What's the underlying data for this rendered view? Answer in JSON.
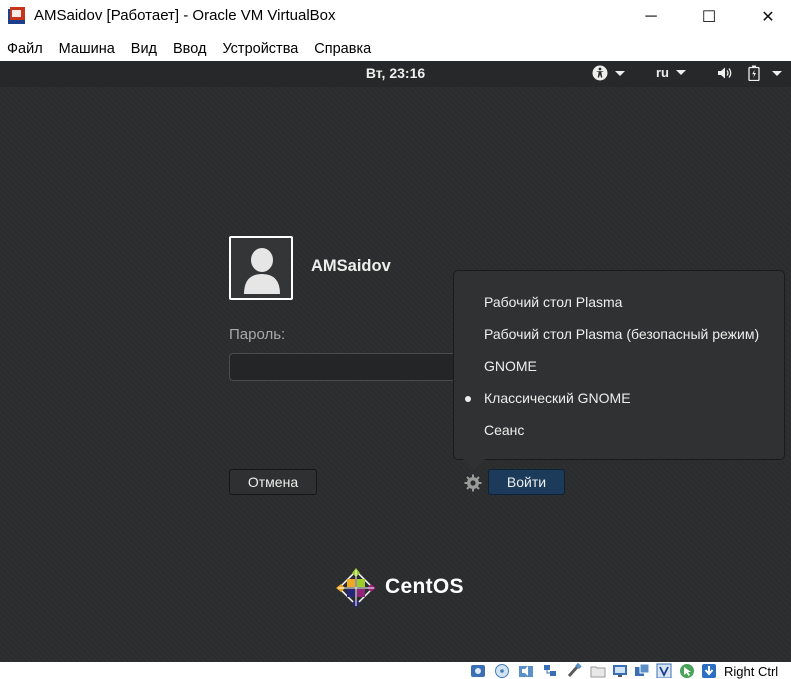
{
  "window": {
    "title": "AMSaidov [Работает] - Oracle VM VirtualBox",
    "controls": {
      "minimize": "─",
      "maximize": "☐",
      "close": "✕"
    }
  },
  "menu": {
    "items": [
      {
        "label": "Файл"
      },
      {
        "label": "Машина"
      },
      {
        "label": "Вид"
      },
      {
        "label": "Ввод"
      },
      {
        "label": "Устройства"
      },
      {
        "label": "Справка"
      }
    ]
  },
  "topbar": {
    "clock": "Вт, 23:16",
    "language": "ru",
    "icons": [
      "accessibility-icon",
      "volume-icon",
      "battery-icon"
    ]
  },
  "login": {
    "username": "AMSaidov",
    "password_label": "Пароль:",
    "password_value": "",
    "cancel_label": "Отмена",
    "login_label": "Войти"
  },
  "session_menu": {
    "items": [
      {
        "label": "Рабочий стол Plasma",
        "selected": false
      },
      {
        "label": "Рабочий стол Plasma (безопасный режим)",
        "selected": false
      },
      {
        "label": "GNOME",
        "selected": false
      },
      {
        "label": "Классический GNOME",
        "selected": true
      },
      {
        "label": "Сеанс",
        "selected": false
      }
    ]
  },
  "branding": {
    "logo_text": "CentOS"
  },
  "statusbar": {
    "host_key": "Right Ctrl",
    "icons": [
      "hard-disk-icon",
      "optical-drive-icon",
      "audio-icon",
      "network-icon",
      "usb-icon",
      "shared-folders-icon",
      "display-icon",
      "video-capture-icon",
      "virtualization-icon",
      "mouse-integration-icon",
      "host-key-icon"
    ]
  },
  "colors": {
    "desktop_bg": "#2b2d2f",
    "topbar_bg": "#262829",
    "login_button": "#1c3b5a",
    "popover_bg": "#2f3133"
  }
}
